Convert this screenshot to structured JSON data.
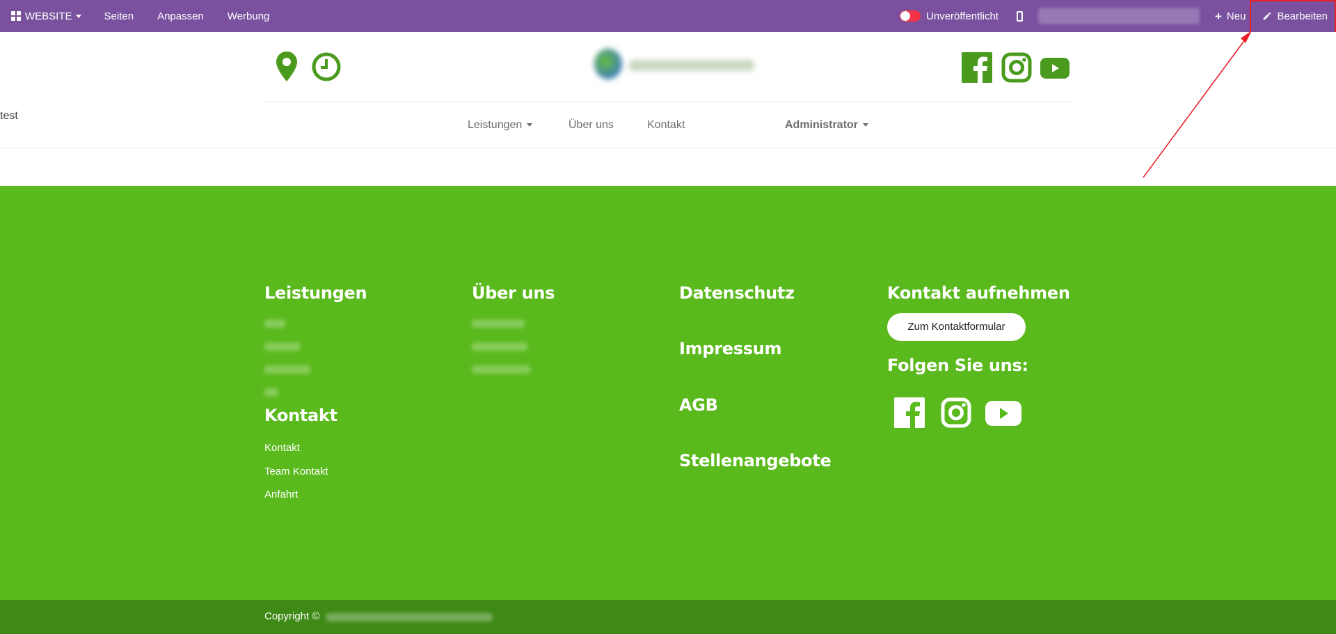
{
  "adminbar": {
    "website_label": "WEBSITE",
    "menu": [
      "Seiten",
      "Anpassen",
      "Werbung"
    ],
    "publish_status": "Unveröffentlicht",
    "new_label": "Neu",
    "edit_label": "Bearbeiten",
    "bar_color": "#7a519f",
    "toggle_color": "#f4324a"
  },
  "header": {
    "nav": {
      "services": "Leistungen",
      "about": "Über uns",
      "contact": "Kontakt",
      "test": "test",
      "admin": "Administrator"
    },
    "icons": [
      "map-marker-icon",
      "clock-icon",
      "facebook-icon",
      "instagram-icon",
      "youtube-icon"
    ],
    "accent_color": "#5ab81c"
  },
  "footer": {
    "color": "#5ab91c",
    "services_title": "Leistungen",
    "about_title": "Über uns",
    "contact_title": "Kontakt",
    "contact_links": [
      "Kontakt",
      "Team Kontakt",
      "Anfahrt"
    ],
    "privacy": "Datenschutz",
    "imprint": "Impressum",
    "terms": "AGB",
    "jobs": "Stellenangebote",
    "get_in_touch": "Kontakt aufnehmen",
    "contact_form_button": "Zum Kontaktformular",
    "follow_us": "Folgen Sie uns:",
    "social_icons": [
      "facebook-icon",
      "instagram-icon",
      "youtube-icon"
    ]
  },
  "copyright": {
    "text": "Copyright ©",
    "color": "#3f8a17"
  },
  "annotation": {
    "color": "#e8202a"
  }
}
